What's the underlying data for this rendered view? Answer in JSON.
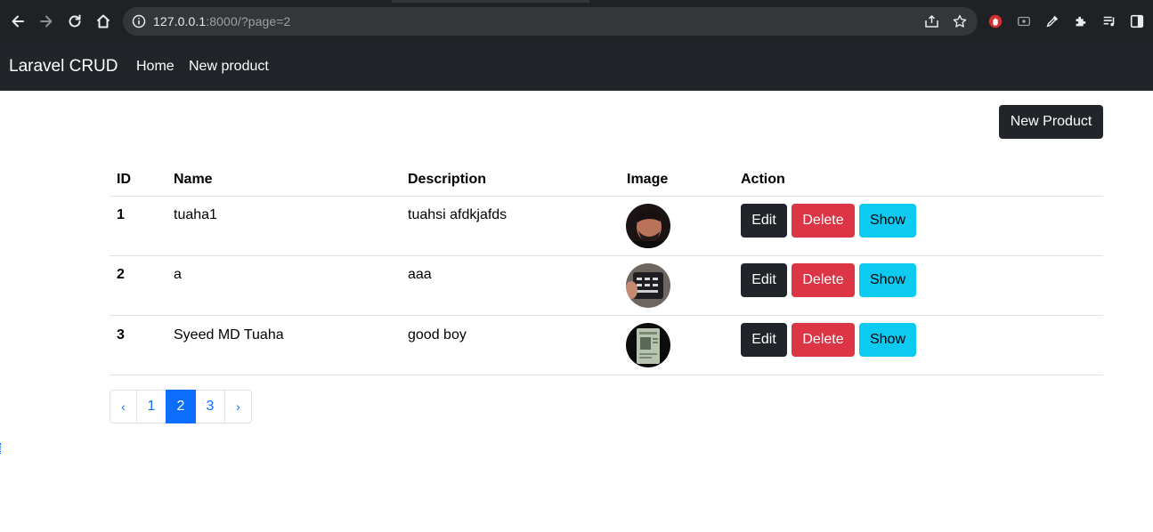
{
  "browser": {
    "url_host": "127.0.0.1",
    "url_rest": ":8000/?page=2",
    "icons": [
      "back-icon",
      "forward-icon",
      "reload-icon",
      "home-icon",
      "info-icon",
      "share-icon",
      "bookmark-star-icon",
      "extension-icon",
      "puzzle-icon",
      "media-icon",
      "sidepanel-icon"
    ]
  },
  "navbar": {
    "brand": "Laravel CRUD",
    "links": [
      {
        "label": "Home"
      },
      {
        "label": "New product"
      }
    ]
  },
  "main": {
    "new_product_label": "New Product",
    "table": {
      "headers": {
        "id": "ID",
        "name": "Name",
        "description": "Description",
        "image": "Image",
        "action": "Action"
      },
      "rows": [
        {
          "id": "1",
          "name": "tuaha1",
          "description": "tuahsi afdkjafds",
          "image_desc": "person-photo",
          "edit": "Edit",
          "delete": "Delete",
          "show": "Show"
        },
        {
          "id": "2",
          "name": "a",
          "description": "aaa",
          "image_desc": "device-photo",
          "edit": "Edit",
          "delete": "Delete",
          "show": "Show"
        },
        {
          "id": "3",
          "name": "Syeed MD Tuaha",
          "description": "good boy",
          "image_desc": "id-card-photo",
          "edit": "Edit",
          "delete": "Delete",
          "show": "Show"
        }
      ]
    },
    "pagination": {
      "prev": "‹",
      "pages": [
        "1",
        "2",
        "3"
      ],
      "active_page": "2",
      "next": "›"
    }
  },
  "colors": {
    "navbar": "#212529",
    "primary": "#0d6efd",
    "danger": "#dc3545",
    "info": "#0dcaf0",
    "dark": "#212529"
  }
}
